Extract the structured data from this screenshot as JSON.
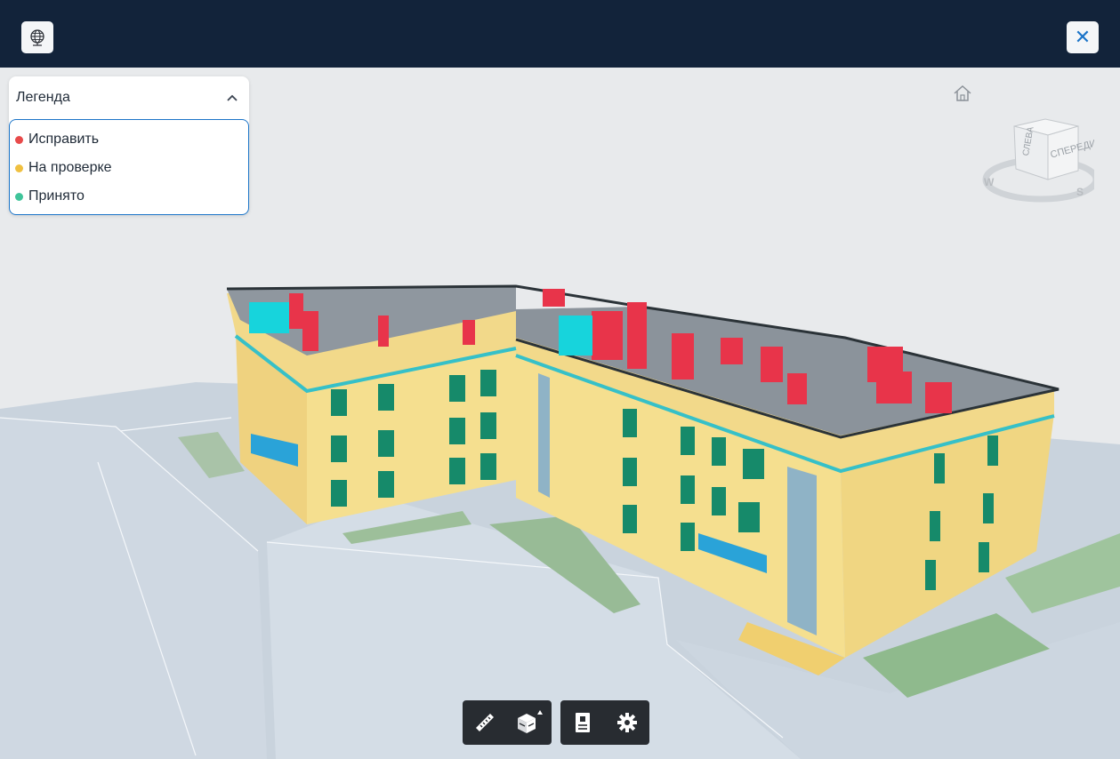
{
  "header": {
    "globe_button_icon": "globe-icon",
    "close_button_icon": "close-icon",
    "close_symbol": "✕"
  },
  "legend": {
    "title": "Легенда",
    "toggle_icon": "chevron-up-icon",
    "items": [
      {
        "label": "Исправить",
        "color": "#e84a4a"
      },
      {
        "label": "На проверке",
        "color": "#f0c040"
      },
      {
        "label": "Принято",
        "color": "#3fc49a"
      }
    ]
  },
  "navigation": {
    "home_icon": "home-icon",
    "viewcube_faces": {
      "left": "СЛЕВА",
      "front": "СПЕРЕДИ"
    },
    "compass": {
      "west": "W",
      "south": "S"
    }
  },
  "toolbar": {
    "group1": [
      {
        "name": "measure-ruler-icon"
      },
      {
        "name": "section-box-icon"
      }
    ],
    "group2": [
      {
        "name": "properties-panel-icon"
      },
      {
        "name": "settings-gear-icon"
      }
    ]
  },
  "colors": {
    "header_bg": "#12233a",
    "accent": "#1b74c8",
    "issue_red": "#e84a4a",
    "review_yellow": "#f0c040",
    "accepted_green": "#3fc49a",
    "facade": "#f5df8f",
    "glass_teal": "#17a0a0"
  }
}
